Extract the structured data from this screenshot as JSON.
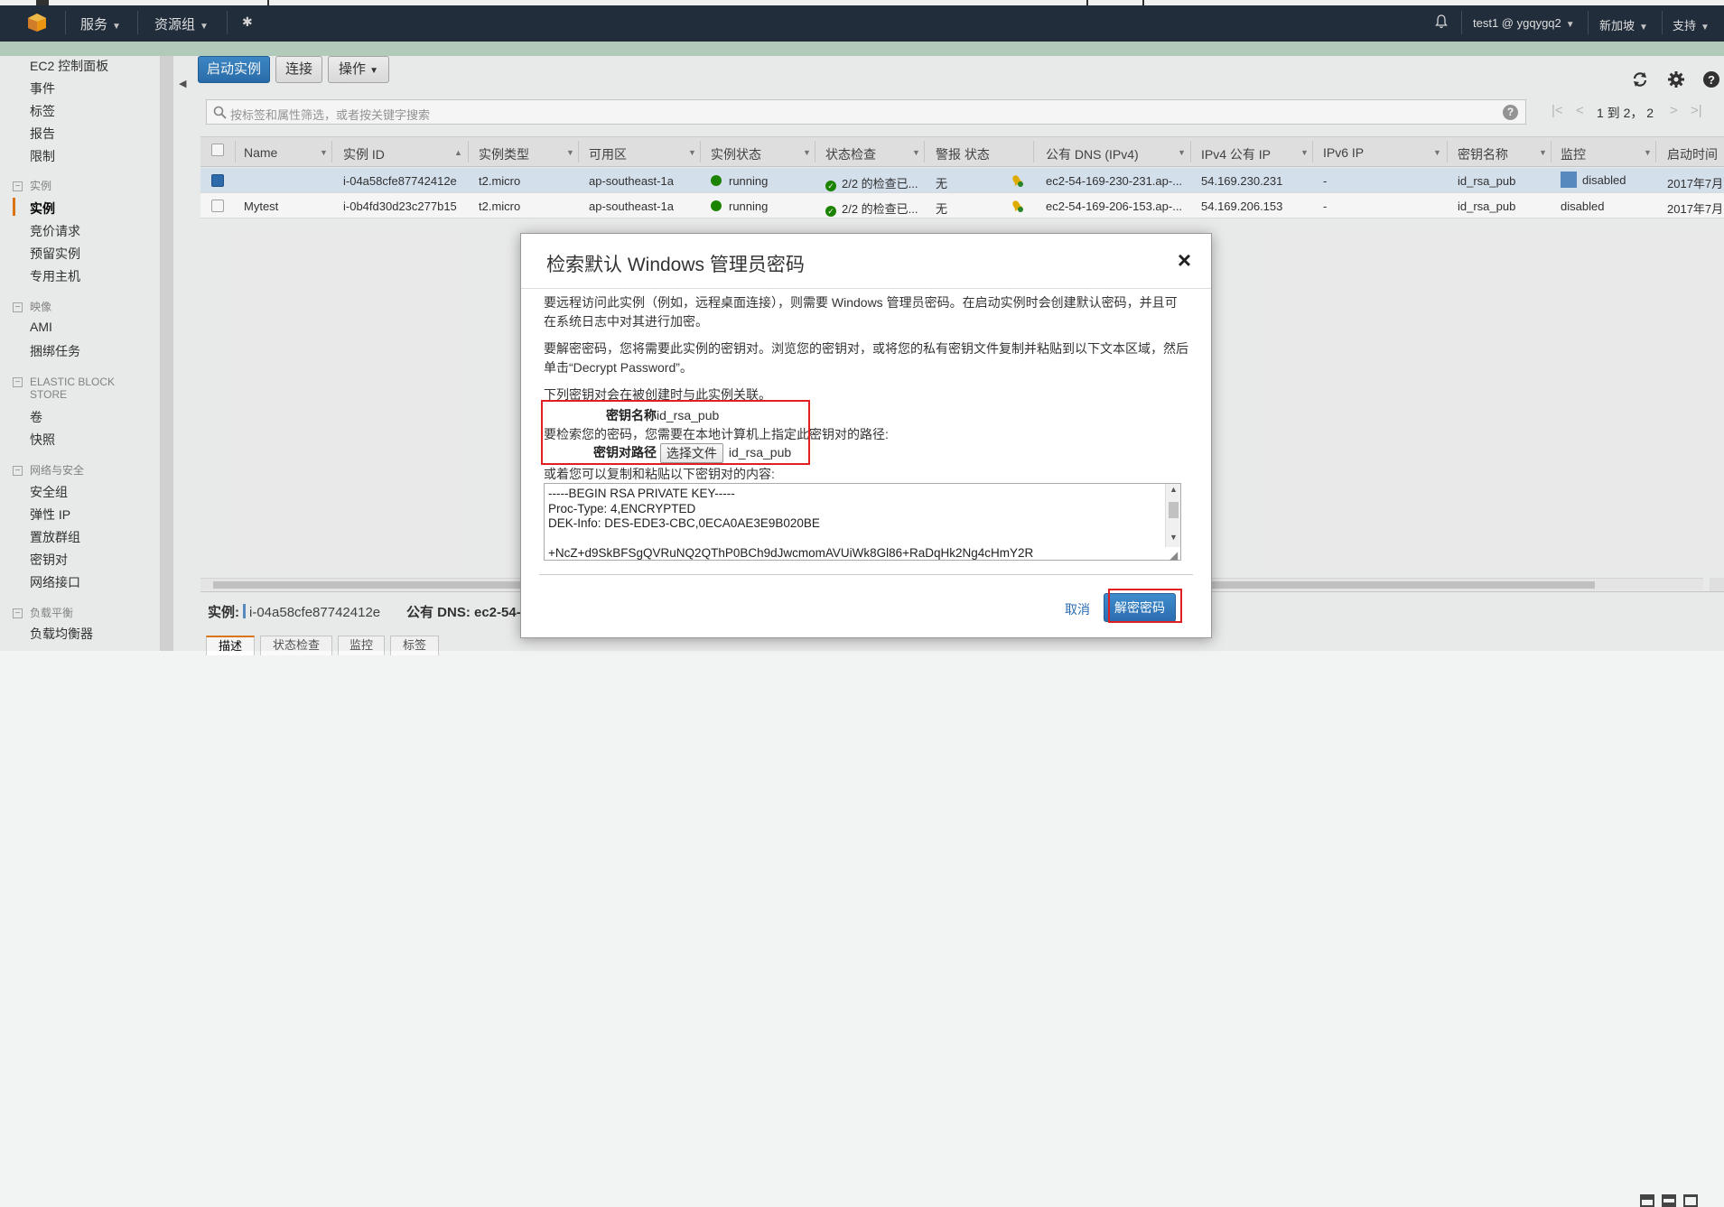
{
  "topnav": {
    "services": "服务",
    "resource_groups": "资源组",
    "user": "test1 @ ygqygq2",
    "region": "新加坡",
    "support": "支持"
  },
  "sidebar": {
    "items": [
      {
        "label": "EC2 控制面板"
      },
      {
        "label": "事件"
      },
      {
        "label": "标签"
      },
      {
        "label": "报告"
      },
      {
        "label": "限制"
      }
    ],
    "group_instances": "实例",
    "instances_items": [
      {
        "label": "实例"
      },
      {
        "label": "竞价请求"
      },
      {
        "label": "预留实例"
      },
      {
        "label": "专用主机"
      }
    ],
    "group_images": "映像",
    "images_items": [
      {
        "label": "AMI"
      },
      {
        "label": "捆绑任务"
      }
    ],
    "group_ebs_line1": "ELASTIC BLOCK",
    "group_ebs_line2": "STORE",
    "ebs_items": [
      {
        "label": "卷"
      },
      {
        "label": "快照"
      }
    ],
    "group_network": "网络与安全",
    "network_items": [
      {
        "label": "安全组"
      },
      {
        "label": "弹性 IP"
      },
      {
        "label": "置放群组"
      },
      {
        "label": "密钥对"
      },
      {
        "label": "网络接口"
      }
    ],
    "group_lb": "负载平衡",
    "lb_items": [
      {
        "label": "负载均衡器"
      }
    ]
  },
  "toolbar": {
    "launch": "启动实例",
    "connect": "连接",
    "actions": "操作"
  },
  "search": {
    "placeholder": "按标签和属性筛选，或者按关键字搜索"
  },
  "pagination": {
    "text": "1 到 2， 2"
  },
  "table": {
    "columns": [
      "Name",
      "实例 ID",
      "实例类型",
      "可用区",
      "实例状态",
      "状态检查",
      "警报 状态",
      "公有 DNS (IPv4)",
      "IPv4 公有 IP",
      "IPv6 IP",
      "密钥名称",
      "监控",
      "启动时间"
    ],
    "rows": [
      {
        "name": "",
        "id": "i-04a58cfe87742412e",
        "type": "t2.micro",
        "az": "ap-southeast-1a",
        "state": "running",
        "checks": "2/2 的检查已...",
        "alarm": "无",
        "dns": "ec2-54-169-230-231.ap-...",
        "ip": "54.169.230.231",
        "ipv6": "-",
        "key": "id_rsa_pub",
        "monitor": "disabled",
        "launch": "2017年7月"
      },
      {
        "name": "Mytest",
        "id": "i-0b4fd30d23c277b15",
        "type": "t2.micro",
        "az": "ap-southeast-1a",
        "state": "running",
        "checks": "2/2 的检查已...",
        "alarm": "无",
        "dns": "ec2-54-169-206-153.ap-...",
        "ip": "54.169.206.153",
        "ipv6": "-",
        "key": "id_rsa_pub",
        "monitor": "disabled",
        "launch": "2017年7月"
      }
    ]
  },
  "bottom": {
    "instance_label": "实例:",
    "instance_id": "i-04a58cfe87742412e",
    "dns_label": "公有 DNS: ec2-54-1",
    "tabs": [
      "描述",
      "状态检查",
      "监控",
      "标签"
    ]
  },
  "modal": {
    "title": "检索默认 Windows 管理员密码",
    "close": "×",
    "p1": "要远程访问此实例（例如，远程桌面连接），则需要 Windows 管理员密码。在启动实例时会创建默认密码，并且可在系统日志中对其进行加密。",
    "p2": "要解密密码，您将需要此实例的密钥对。浏览您的密钥对，或将您的私有密钥文件复制并粘贴到以下文本区域，然后单击“Decrypt Password”。",
    "p3": "下列密钥对会在被创建时与此实例关联。",
    "key_name_label": "密钥名称",
    "key_name_value": "id_rsa_pub",
    "need_path": "要检索您的密码，您需要在本地计算机上指定此密钥对的路径:",
    "key_path_label": "密钥对路径",
    "choose_file": "选择文件",
    "chosen_file": "id_rsa_pub",
    "or_paste": "或着您可以复制和粘贴以下密钥对的内容:",
    "key_content": "-----BEGIN RSA PRIVATE KEY-----\nProc-Type: 4,ENCRYPTED\nDEK-Info: DES-EDE3-CBC,0ECA0AE3E9B020BE\n\n+NcZ+d9SkBFSgQVRuNQ2QThP0BCh9dJwcmomAVUiWk8Gl86+RaDqHk2Ng4cHmY2R",
    "cancel": "取消",
    "decrypt": "解密密码"
  }
}
